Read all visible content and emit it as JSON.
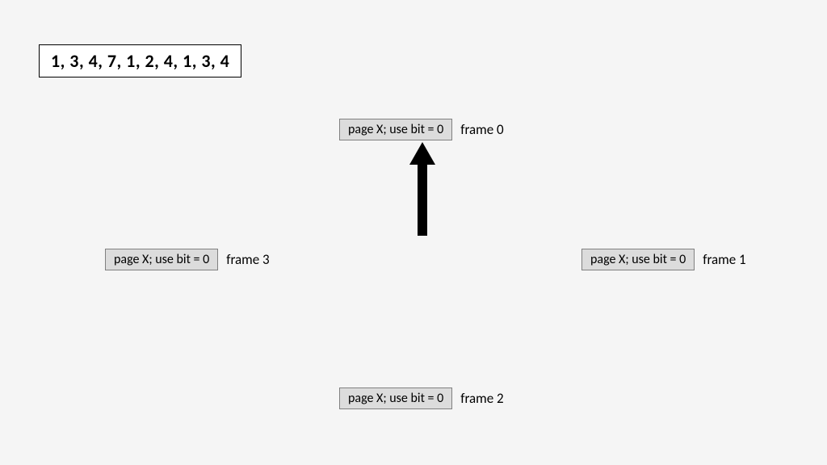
{
  "sequence": "1, 3, 4, 7, 1, 2, 4, 1, 3, 4",
  "frames": {
    "f0": {
      "box": "page X; use bit = 0",
      "label": "frame 0"
    },
    "f1": {
      "box": "page X; use bit = 0",
      "label": "frame 1"
    },
    "f2": {
      "box": "page X; use bit = 0",
      "label": "frame 2"
    },
    "f3": {
      "box": "page X; use bit = 0",
      "label": "frame 3"
    }
  },
  "arrow_target": "f0"
}
